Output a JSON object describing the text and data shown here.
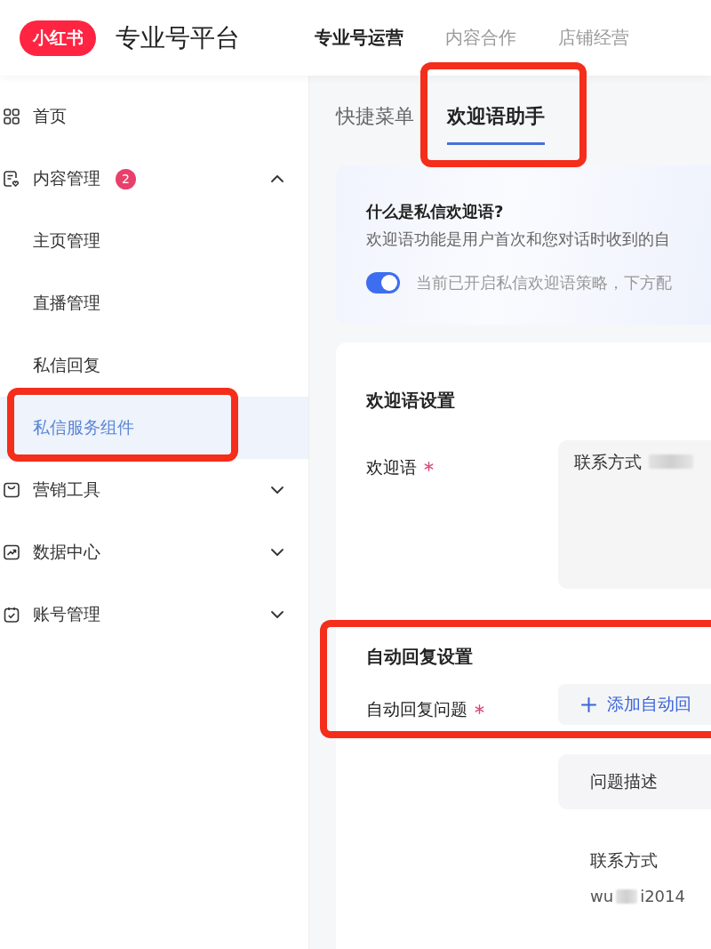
{
  "header": {
    "logo": "小红书",
    "title": "专业号平台",
    "nav": [
      {
        "label": "专业号运营",
        "selected": true
      },
      {
        "label": "内容合作",
        "selected": false
      },
      {
        "label": "店铺经营",
        "selected": false
      }
    ]
  },
  "sidebar": {
    "items": [
      {
        "label": "首页",
        "kind": "link",
        "selected": false,
        "highlighted": false
      },
      {
        "label": "内容管理",
        "kind": "group",
        "badge": "2",
        "expanded": true,
        "selected": false,
        "highlighted": false,
        "children": [
          {
            "label": "主页管理",
            "selected": false,
            "highlighted": false
          },
          {
            "label": "直播管理",
            "selected": false,
            "highlighted": false
          },
          {
            "label": "私信回复",
            "selected": false,
            "highlighted": false
          },
          {
            "label": "私信服务组件",
            "selected": true,
            "highlighted": true
          }
        ]
      },
      {
        "label": "营销工具",
        "kind": "group",
        "expanded": false,
        "selected": false,
        "highlighted": false
      },
      {
        "label": "数据中心",
        "kind": "group",
        "expanded": false,
        "selected": false,
        "highlighted": false
      },
      {
        "label": "账号管理",
        "kind": "group",
        "expanded": false,
        "selected": false,
        "highlighted": false
      }
    ]
  },
  "main": {
    "tabs": [
      {
        "label": "快捷菜单",
        "selected": false,
        "highlighted": false
      },
      {
        "label": "欢迎语助手",
        "selected": true,
        "highlighted": true
      }
    ],
    "intro": {
      "title": "什么是私信欢迎语?",
      "description": "欢迎语功能是用户首次和您对话时收到的自",
      "toggle": {
        "on": true,
        "label": "当前已开启私信欢迎语策略，下方配"
      }
    },
    "welcome_settings": {
      "title": "欢迎语设置",
      "field": {
        "label": "欢迎语",
        "required": true,
        "value": "联系方式",
        "redacted": true
      }
    },
    "auto_reply": {
      "title": "自动回复设置",
      "highlighted": true,
      "field": {
        "label": "自动回复问题",
        "required": true
      },
      "add_button": "添加自动回",
      "list_header": "问题描述",
      "items": [
        {
          "question": "联系方式",
          "answer_parts": [
            "wu",
            "i2014"
          ],
          "redacted": true
        }
      ]
    }
  }
}
